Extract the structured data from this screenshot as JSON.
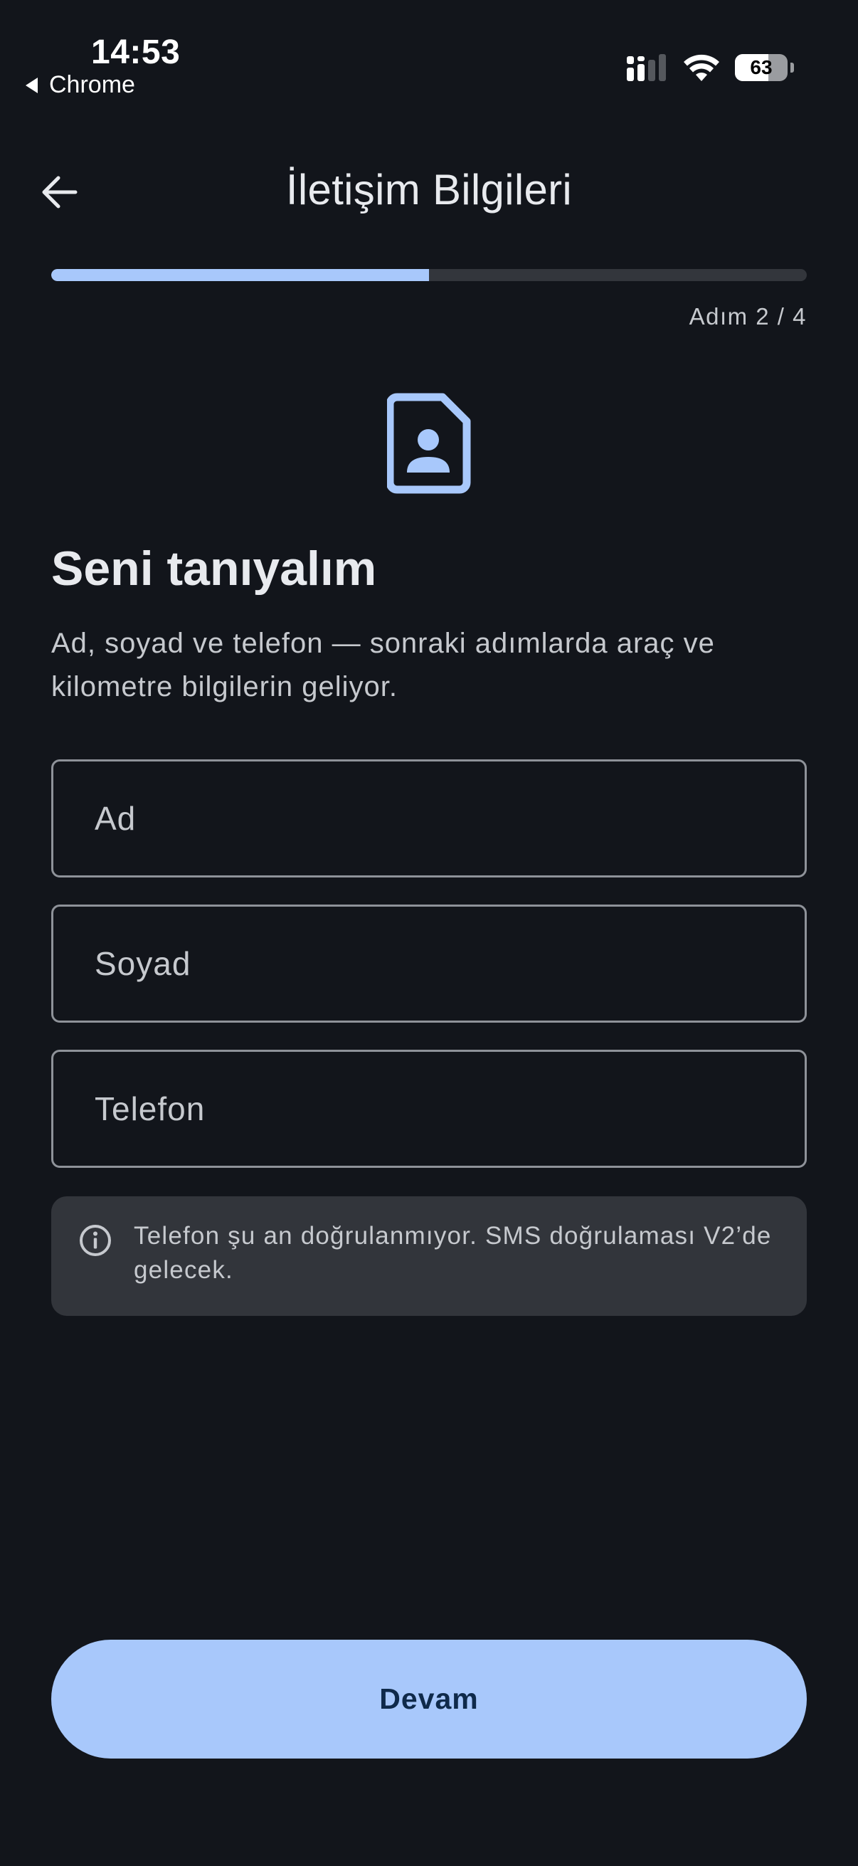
{
  "status_bar": {
    "time": "14:53",
    "back_app": "Chrome",
    "battery_level": 63,
    "battery_label": "63"
  },
  "header": {
    "title": "İletişim Bilgileri"
  },
  "progress": {
    "fraction": 0.5,
    "label": "Adım 2 / 4"
  },
  "intro": {
    "icon": "contact-card-icon",
    "title": "Seni tanıyalım",
    "description": "Ad, soyad ve telefon — sonraki adımlarda araç ve kilometre bilgilerin geliyor."
  },
  "form": {
    "first_name_placeholder": "Ad",
    "last_name_placeholder": "Soyad",
    "phone_placeholder": "Telefon"
  },
  "info": {
    "icon": "info-icon",
    "text": "Telefon şu an doğrulanmıyor. SMS doğrulaması V2’de gelecek."
  },
  "actions": {
    "continue_label": "Devam"
  },
  "colors": {
    "background": "#12151b",
    "accent": "#a8c8fb",
    "accent_text": "#0f2a4a",
    "track": "#33363c",
    "info_bg": "#32353b"
  }
}
